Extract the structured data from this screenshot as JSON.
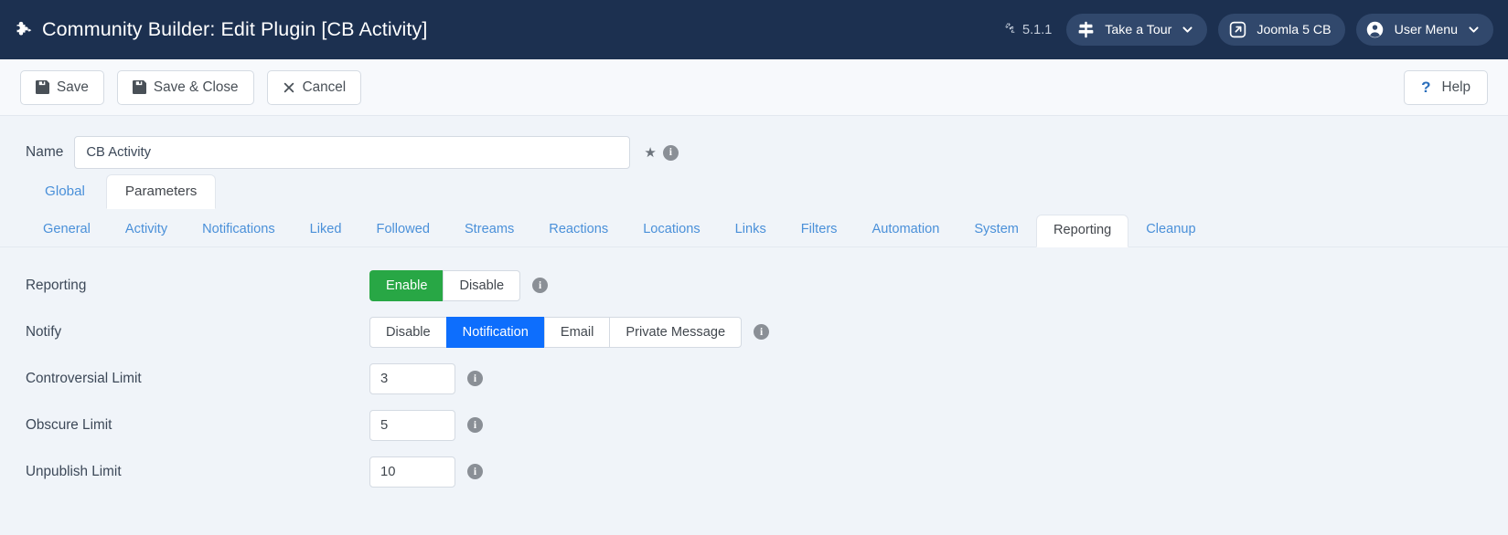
{
  "header": {
    "title": "Community Builder: Edit Plugin [CB Activity]",
    "title_icon": "puzzle-piece-icon",
    "version": "5.1.1",
    "version_icon": "joomla-icon",
    "tour_label": "Take a Tour",
    "tour_icon": "signpost-icon",
    "site_label": "Joomla 5 CB",
    "site_icon": "external-link-icon",
    "user_label": "User Menu",
    "user_icon": "user-circle-icon",
    "chevron_icon": "chevron-down-icon",
    "bg_color": "#1c3050",
    "pill_color": "#31486c"
  },
  "toolbar": {
    "save_label": "Save",
    "save_icon": "floppy-disk-icon",
    "save_close_label": "Save & Close",
    "save_close_icon": "floppy-disk-icon",
    "cancel_label": "Cancel",
    "cancel_icon": "close-x-icon",
    "help_label": "Help",
    "help_icon": "question-mark-icon"
  },
  "name_field": {
    "label": "Name",
    "value": "CB Activity",
    "placeholder": "",
    "star_icon": "star-icon",
    "info_icon": "info-icon"
  },
  "primary_tabs": [
    {
      "label": "Global",
      "active": false
    },
    {
      "label": "Parameters",
      "active": true
    }
  ],
  "sub_tabs": [
    {
      "label": "General",
      "active": false
    },
    {
      "label": "Activity",
      "active": false
    },
    {
      "label": "Notifications",
      "active": false
    },
    {
      "label": "Liked",
      "active": false
    },
    {
      "label": "Followed",
      "active": false
    },
    {
      "label": "Streams",
      "active": false
    },
    {
      "label": "Reactions",
      "active": false
    },
    {
      "label": "Locations",
      "active": false
    },
    {
      "label": "Links",
      "active": false
    },
    {
      "label": "Filters",
      "active": false
    },
    {
      "label": "Automation",
      "active": false
    },
    {
      "label": "System",
      "active": false
    },
    {
      "label": "Reporting",
      "active": true
    },
    {
      "label": "Cleanup",
      "active": false
    }
  ],
  "form": {
    "reporting": {
      "label": "Reporting",
      "options": [
        {
          "label": "Enable",
          "state": "green"
        },
        {
          "label": "Disable",
          "state": "off"
        }
      ]
    },
    "notify": {
      "label": "Notify",
      "options": [
        {
          "label": "Disable",
          "state": "off"
        },
        {
          "label": "Notification",
          "state": "blue"
        },
        {
          "label": "Email",
          "state": "off"
        },
        {
          "label": "Private Message",
          "state": "off"
        }
      ]
    },
    "controversial_limit": {
      "label": "Controversial Limit",
      "value": "3"
    },
    "obscure_limit": {
      "label": "Obscure Limit",
      "value": "5"
    },
    "unpublish_limit": {
      "label": "Unpublish Limit",
      "value": "10"
    }
  },
  "colors": {
    "accent_green": "#28a745",
    "accent_blue": "#0d6efd",
    "link_blue": "#4a90d9",
    "page_bg": "#f0f4f9"
  }
}
